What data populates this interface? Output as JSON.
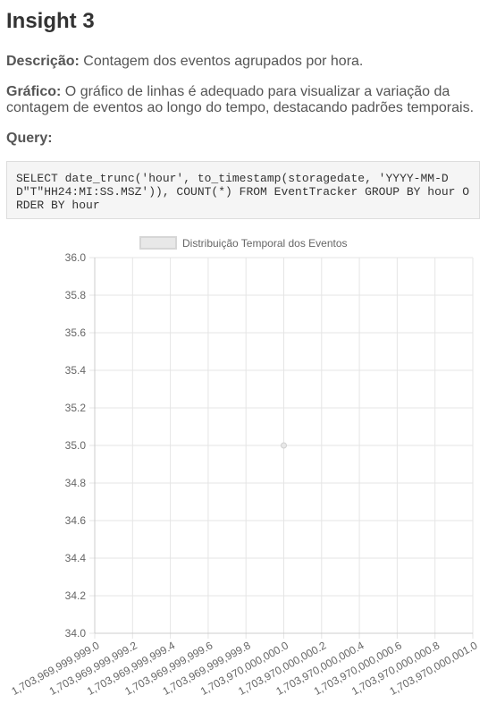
{
  "insight": {
    "title": "Insight 3",
    "description_label": "Descrição:",
    "description_text": "Contagem dos eventos agrupados por hora.",
    "chart_label": "Gráfico:",
    "chart_text": "O gráfico de linhas é adequado para visualizar a variação da contagem de eventos ao longo do tempo, destacando padrões temporais.",
    "query_label": "Query:",
    "query_text": "SELECT date_trunc('hour', to_timestamp(storagedate, 'YYYY-MM-DD\"T\"HH24:MI:SS.MSZ')), COUNT(*) FROM EventTracker GROUP BY hour ORDER BY hour"
  },
  "colors": {
    "grid": "#e5e5e5",
    "axis": "#cccccc",
    "tick_text": "#666666",
    "point_fill": "#e8e8e8",
    "point_stroke": "#d0d0d0",
    "legend_fill": "#e8e8e8",
    "legend_stroke": "#d6d6d6"
  },
  "chart_data": {
    "type": "line",
    "legend": "Distribuição Temporal dos Eventos",
    "legend_position": "top",
    "grid": true,
    "xlim": [
      1703969999999.0,
      1703970000001.0
    ],
    "ylim": [
      34.0,
      36.0
    ],
    "x_ticks": [
      "1,703,969,999,999.0",
      "1,703,969,999,999.2",
      "1,703,969,999,999.4",
      "1,703,969,999,999.6",
      "1,703,969,999,999.8",
      "1,703,970,000,000.0",
      "1,703,970,000,000.2",
      "1,703,970,000,000.4",
      "1,703,970,000,000.6",
      "1,703,970,000,000.8",
      "1,703,970,000,001.0"
    ],
    "y_ticks": [
      "34.0",
      "34.2",
      "34.4",
      "34.6",
      "34.8",
      "35.0",
      "35.2",
      "35.4",
      "35.6",
      "35.8",
      "36.0"
    ],
    "series": [
      {
        "name": "Distribuição Temporal dos Eventos",
        "points": [
          {
            "x": 1703970000000.0,
            "y": 35.0
          }
        ]
      }
    ]
  }
}
